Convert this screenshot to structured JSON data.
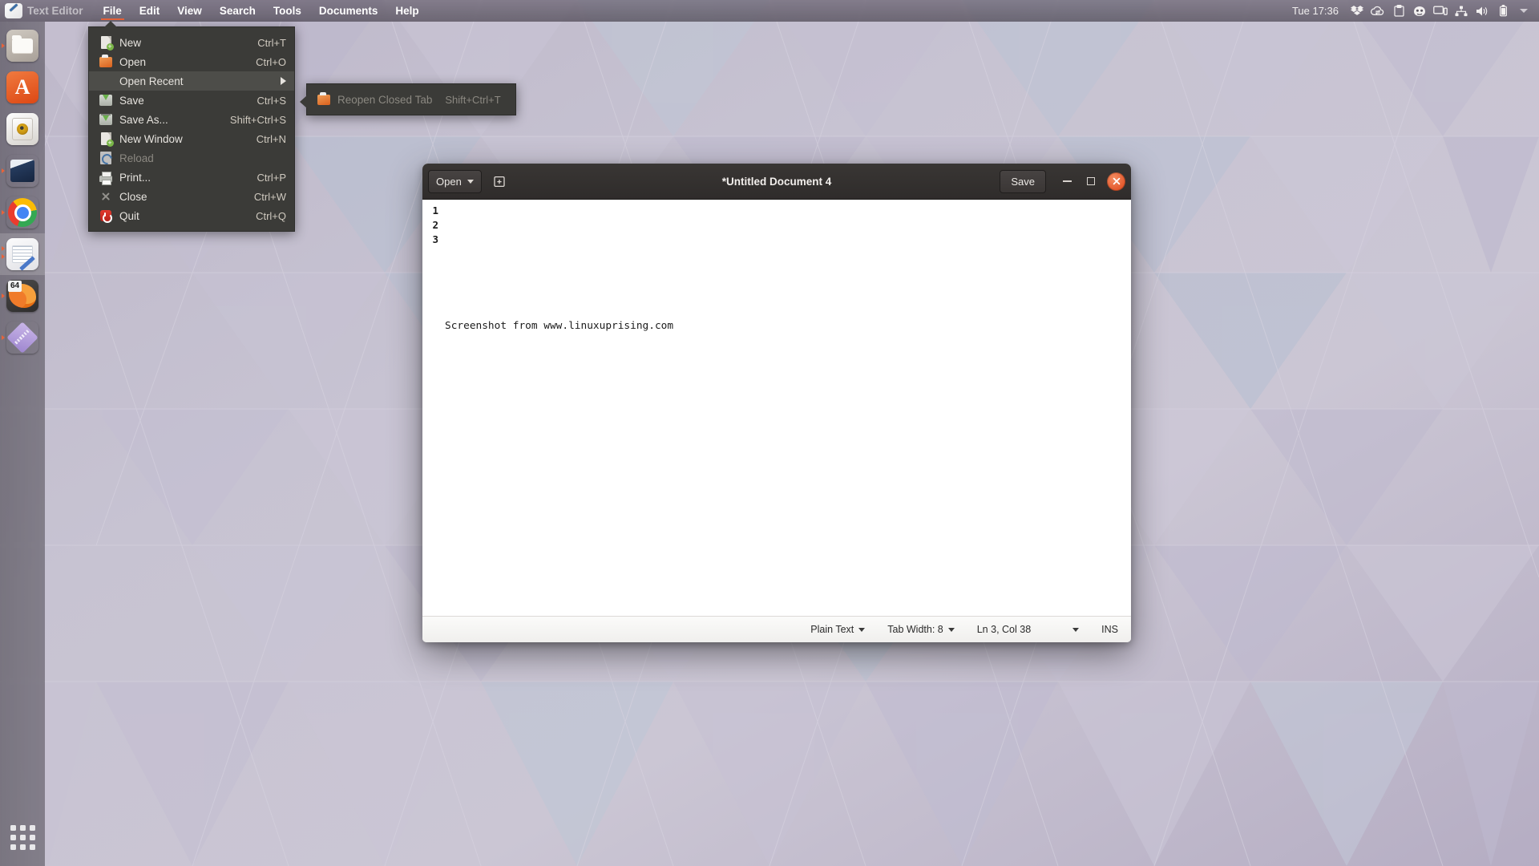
{
  "panel": {
    "app_icon": "gedit-icon",
    "app_name": "Text Editor",
    "menus": [
      {
        "label": "File",
        "active": true
      },
      {
        "label": "Edit",
        "active": false
      },
      {
        "label": "View",
        "active": false
      },
      {
        "label": "Search",
        "active": false
      },
      {
        "label": "Tools",
        "active": false
      },
      {
        "label": "Documents",
        "active": false
      },
      {
        "label": "Help",
        "active": false
      }
    ],
    "clock": "Tue 17:36",
    "tray": [
      {
        "name": "dropbox-icon"
      },
      {
        "name": "sync-cloud-icon"
      },
      {
        "name": "clipboard-icon"
      },
      {
        "name": "bot-face-icon"
      },
      {
        "name": "display-icon"
      },
      {
        "name": "network-icon"
      },
      {
        "name": "volume-icon"
      },
      {
        "name": "battery-icon"
      },
      {
        "name": "chevron-down-icon"
      }
    ]
  },
  "launcher": {
    "items": [
      {
        "name": "launcher-item-files",
        "icon": "files-icon",
        "pips": 1,
        "focused": false
      },
      {
        "name": "launcher-item-software",
        "icon": "ubuntu-software-icon",
        "pips": 0,
        "focused": false
      },
      {
        "name": "launcher-item-rhythmbox",
        "icon": "rhythmbox-icon",
        "pips": 0,
        "focused": false
      },
      {
        "name": "launcher-item-virtualbox",
        "icon": "virtualbox-icon",
        "pips": 1,
        "focused": false
      },
      {
        "name": "launcher-item-chrome",
        "icon": "google-chrome-icon",
        "pips": 1,
        "focused": false
      },
      {
        "name": "launcher-item-text-editor",
        "icon": "gedit-icon",
        "pips": 2,
        "focused": true
      },
      {
        "name": "launcher-item-gimp",
        "icon": "gimp-icon",
        "pips": 1,
        "focused": false,
        "badge": "64"
      },
      {
        "name": "launcher-item-archive",
        "icon": "archive-manager-icon",
        "pips": 1,
        "focused": false
      }
    ],
    "show_applications_label": "Show Applications"
  },
  "file_menu": {
    "items": [
      {
        "label": "New",
        "accel": "Ctrl+T",
        "icon": "new-document-icon",
        "state": "normal",
        "submenu": false
      },
      {
        "label": "Open",
        "accel": "Ctrl+O",
        "icon": "open-folder-icon",
        "state": "normal",
        "submenu": false
      },
      {
        "label": "Open Recent",
        "accel": "",
        "icon": "none",
        "state": "hover",
        "submenu": true
      },
      {
        "label": "Save",
        "accel": "Ctrl+S",
        "icon": "save-icon",
        "state": "normal",
        "submenu": false
      },
      {
        "label": "Save As...",
        "accel": "Shift+Ctrl+S",
        "icon": "save-as-icon",
        "state": "normal",
        "submenu": false
      },
      {
        "label": "New Window",
        "accel": "Ctrl+N",
        "icon": "new-window-icon",
        "state": "normal",
        "submenu": false
      },
      {
        "label": "Reload",
        "accel": "",
        "icon": "reload-icon",
        "state": "disabled",
        "submenu": false
      },
      {
        "label": "Print...",
        "accel": "Ctrl+P",
        "icon": "print-icon",
        "state": "normal",
        "submenu": false
      },
      {
        "label": "Close",
        "accel": "Ctrl+W",
        "icon": "close-tab-icon",
        "state": "normal",
        "submenu": false
      },
      {
        "label": "Quit",
        "accel": "Ctrl+Q",
        "icon": "quit-icon",
        "state": "normal",
        "submenu": false
      }
    ]
  },
  "open_recent_submenu": {
    "items": [
      {
        "label": "Reopen Closed Tab",
        "accel": "Shift+Ctrl+T",
        "icon": "open-folder-icon",
        "state": "disabled"
      }
    ]
  },
  "gedit_window": {
    "title": "*Untitled Document 4",
    "open_button": "Open",
    "save_button": "Save",
    "new_tab_icon": "new-tab-icon",
    "minimize_icon": "minimize-icon",
    "maximize_icon": "maximize-icon",
    "close_icon": "close-icon",
    "document": {
      "line_numbers": [
        "1",
        "2",
        "3"
      ],
      "lines": [
        "",
        "",
        "Screenshot from www.linuxuprising.com"
      ]
    },
    "statusbar": {
      "language": "Plain Text",
      "tab_width": "Tab Width: 8",
      "position": "Ln 3, Col 38",
      "insert_mode": "INS"
    }
  },
  "colors": {
    "accent_orange": "#e8633a",
    "menu_bg": "#3b3b38",
    "menu_hover": "#4d4d49",
    "headerbar_bg": "#2f2c2b",
    "close_button": "#e3582c"
  }
}
